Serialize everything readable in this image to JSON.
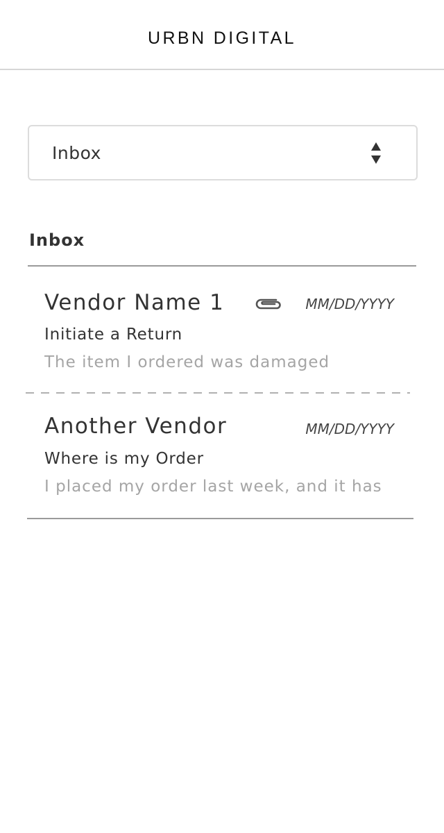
{
  "header": {
    "brand": "URBN DIGITAL"
  },
  "folder_select": {
    "value": "Inbox",
    "icon": "sort-updown-icon"
  },
  "section": {
    "title": "Inbox"
  },
  "messages": [
    {
      "vendor": "Vendor Name 1",
      "has_attachment": true,
      "attachment_icon": "paperclip-icon",
      "date": "MM/DD/YYYY",
      "subject": "Initiate a Return",
      "preview": "The item I ordered was damaged"
    },
    {
      "vendor": "Another Vendor",
      "has_attachment": false,
      "date": "MM/DD/YYYY",
      "subject": "Where is my Order",
      "preview": "I placed my order last week, and it has"
    }
  ],
  "colors": {
    "text_primary": "#333333",
    "text_preview": "#a5a5a5",
    "divider": "#9a9a9a",
    "border": "#dcdcdc"
  }
}
